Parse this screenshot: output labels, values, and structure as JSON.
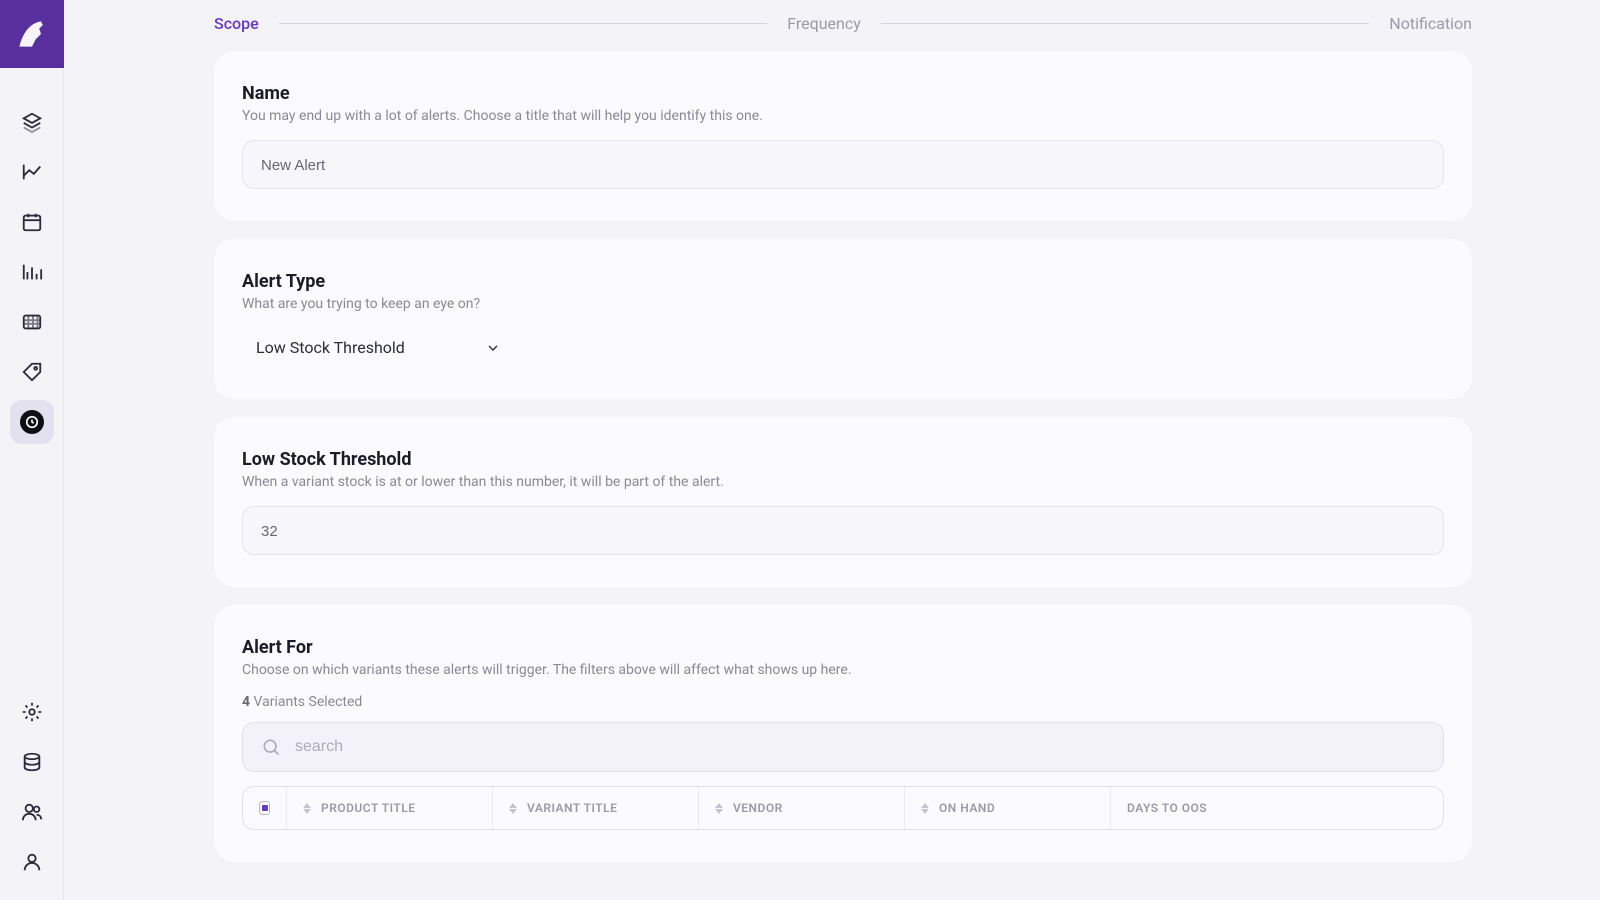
{
  "stepper": {
    "scope": "Scope",
    "frequency": "Frequency",
    "notification": "Notification"
  },
  "name_section": {
    "title": "Name",
    "desc": "You may end up with a lot of alerts. Choose a title that will help you identify this one.",
    "value": "New Alert"
  },
  "type_section": {
    "title": "Alert Type",
    "desc": "What are you trying to keep an eye on?",
    "selected": "Low Stock Threshold"
  },
  "threshold_section": {
    "title": "Low Stock Threshold",
    "desc": "When a variant stock is at or lower than this number, it will be part of the alert.",
    "value": "32"
  },
  "for_section": {
    "title": "Alert For",
    "desc": "Choose on which variants these alerts will trigger. The filters above will affect what shows up here.",
    "count": "4",
    "count_label": " Variants Selected",
    "search_placeholder": "search"
  },
  "table": {
    "product_title": "PRODUCT TITLE",
    "variant_title": "VARIANT TITLE",
    "vendor": "VENDOR",
    "on_hand": "ON HAND",
    "days_to_oos": "DAYS TO OOS"
  }
}
